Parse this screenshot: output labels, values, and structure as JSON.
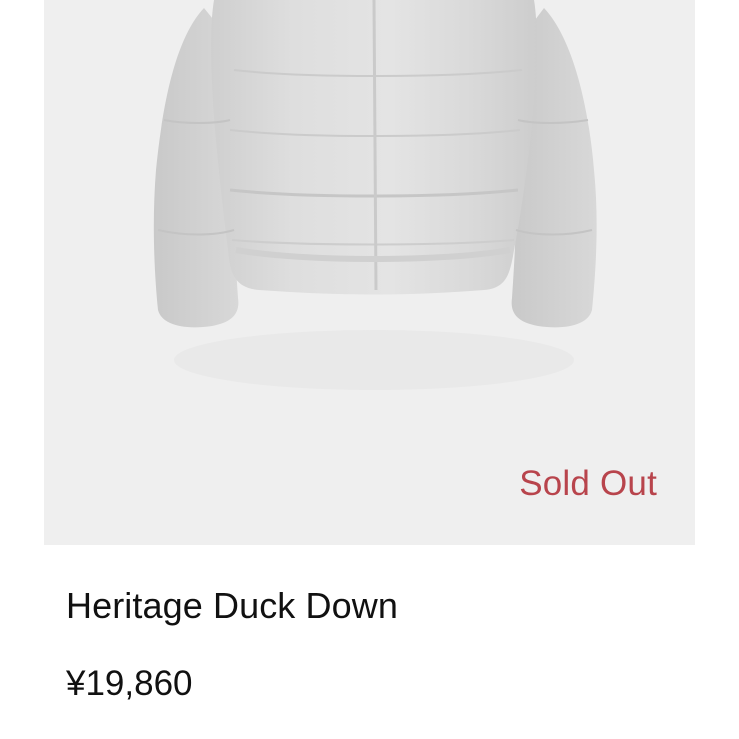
{
  "product": {
    "image_alt": "Heritage Duck Down jacket",
    "status_label": "Sold Out",
    "status_color": "#b8444c",
    "name": "Heritage Duck Down",
    "price": "¥19,860"
  }
}
